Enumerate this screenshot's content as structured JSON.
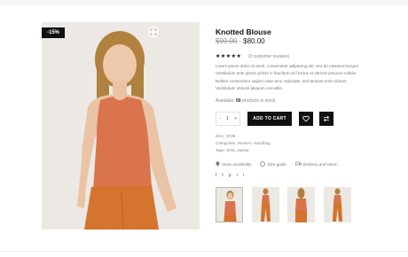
{
  "product": {
    "sale_badge": "-15%",
    "title": "Knotted Blouse",
    "old_price": "$90.00",
    "price_separator": "-",
    "new_price": "$80.00",
    "stars": "★★★★★",
    "reviews": "(3 customer reviews)",
    "description": "Lorem ipsum dolor sit amet, consectetur adipiscing elit, sed do eiusmod tempor. Vestibulum ante ipsum primis in faucibus orci luctus et ultrices posuere cubilia. Nullam consectetur sapien vitae arcu vulputate, sed tempus enim dictum. Vestibulum ultrices aliquam convallis.",
    "stock_prefix": "Available:",
    "stock_count": "50",
    "stock_suffix": "products in stock",
    "quantity": "1",
    "qty_minus": "-",
    "qty_plus": "+",
    "add_to_cart": "ADD TO CART",
    "sku": "SKU: 0038",
    "categories": "Categories: Women, Handbag",
    "tags": "Tags: Shirt, Jacket",
    "links": {
      "store": "Store availability",
      "size": "Size guide",
      "delivery": "Delivery and return"
    },
    "social": {
      "facebook": "f",
      "twitter": "t",
      "pinterest": "p",
      "instagram": "i",
      "rss": "r"
    }
  },
  "colors": {
    "accent": "#111111",
    "skin": "#e9c3a4",
    "top": "#d9744c",
    "pants": "#d4742f",
    "hair": "#b0813f",
    "background": "#ece8e3"
  }
}
